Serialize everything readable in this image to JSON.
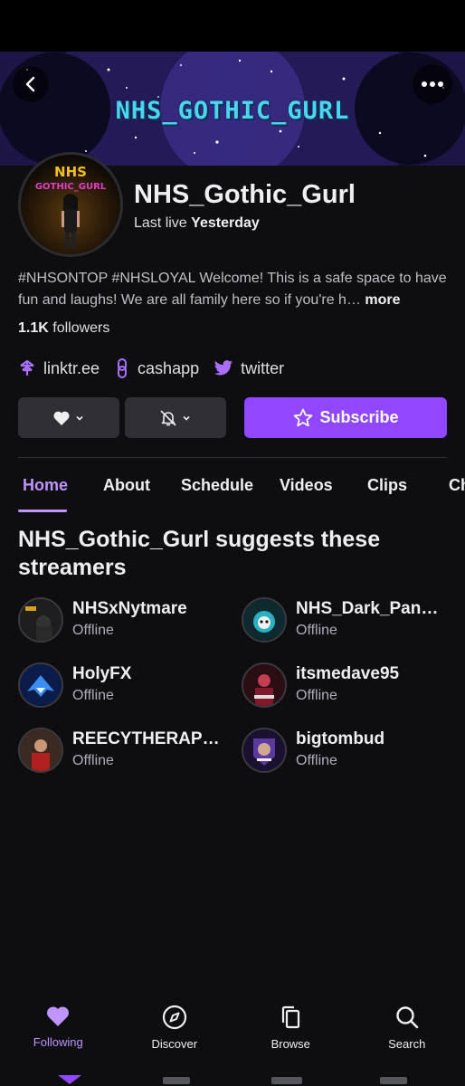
{
  "banner": {
    "title": "NHS_GOTHIC_GURL"
  },
  "avatar": {
    "logo_text": "NHS",
    "logo_subtext": "GOTHIC_GURL"
  },
  "header": {
    "channel_name": "NHS_Gothic_Gurl",
    "last_live_prefix": "Last live",
    "last_live_value": "Yesterday"
  },
  "bio": {
    "text": "#NHSONTOP #NHSLOYAL Welcome! This is a safe space to have fun and laughs! We are all family here so if you're h…",
    "more_label": "more"
  },
  "followers": {
    "count": "1.1K",
    "label": "followers"
  },
  "links": [
    {
      "label": "linktr.ee",
      "icon": "linktree-icon"
    },
    {
      "label": "cashapp",
      "icon": "link-icon"
    },
    {
      "label": "twitter",
      "icon": "twitter-icon"
    }
  ],
  "actions": {
    "subscribe_label": "Subscribe"
  },
  "tabs": [
    "Home",
    "About",
    "Schedule",
    "Videos",
    "Clips",
    "Ch"
  ],
  "suggestions": {
    "title": "NHS_Gothic_Gurl suggests these streamers",
    "items": [
      {
        "name": "NHSxNytmare",
        "status": "Offline"
      },
      {
        "name": "NHS_Dark_Pan…",
        "status": "Offline"
      },
      {
        "name": "HolyFX",
        "status": "Offline"
      },
      {
        "name": "itsmedave95",
        "status": "Offline"
      },
      {
        "name": "REECYTHERAP…",
        "status": "Offline"
      },
      {
        "name": "bigtombud",
        "status": "Offline"
      }
    ]
  },
  "bottom_nav": [
    {
      "label": "Following",
      "icon": "heart-icon",
      "active": true
    },
    {
      "label": "Discover",
      "icon": "compass-icon",
      "active": false
    },
    {
      "label": "Browse",
      "icon": "browse-icon",
      "active": false
    },
    {
      "label": "Search",
      "icon": "search-icon",
      "active": false
    }
  ],
  "colors": {
    "accent": "#9147ff",
    "accent_light": "#bf94ff",
    "background": "#0e0e10",
    "button_bg": "#2f2f35"
  }
}
